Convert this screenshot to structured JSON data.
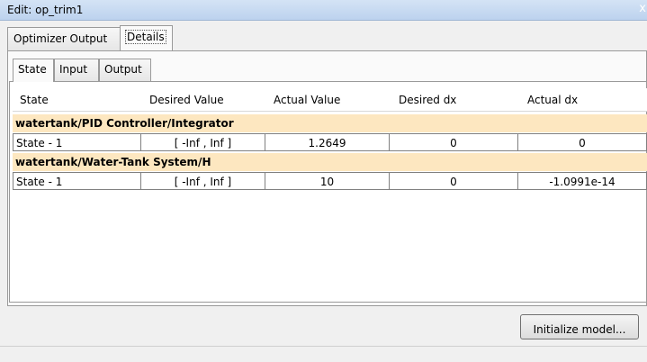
{
  "window": {
    "title": "Edit: op_trim1",
    "close_glyph": "x"
  },
  "tabs": [
    {
      "label": "Optimizer Output",
      "active": false
    },
    {
      "label": "Details",
      "active": true
    }
  ],
  "subtabs": [
    {
      "label": "State",
      "active": true
    },
    {
      "label": "Input",
      "active": false
    },
    {
      "label": "Output",
      "active": false
    }
  ],
  "table": {
    "headers": [
      "State",
      "Desired Value",
      "Actual Value",
      "Desired dx",
      "Actual dx"
    ],
    "groups": [
      {
        "name": "watertank/PID Controller/Integrator",
        "rows": [
          {
            "state": "State - 1",
            "desired": "[ -Inf , Inf ]",
            "actual": "1.2649",
            "desired_dx": "0",
            "actual_dx": "0"
          }
        ]
      },
      {
        "name": "watertank/Water-Tank System/H",
        "rows": [
          {
            "state": "State - 1",
            "desired": "[ -Inf , Inf ]",
            "actual": "10",
            "desired_dx": "0",
            "actual_dx": "-1.0991e-14"
          }
        ]
      }
    ]
  },
  "buttons": {
    "initialize": "Initialize model..."
  },
  "colors": {
    "group_row_bg": "#fde7c0",
    "title_bar": "#c9dcf2"
  }
}
